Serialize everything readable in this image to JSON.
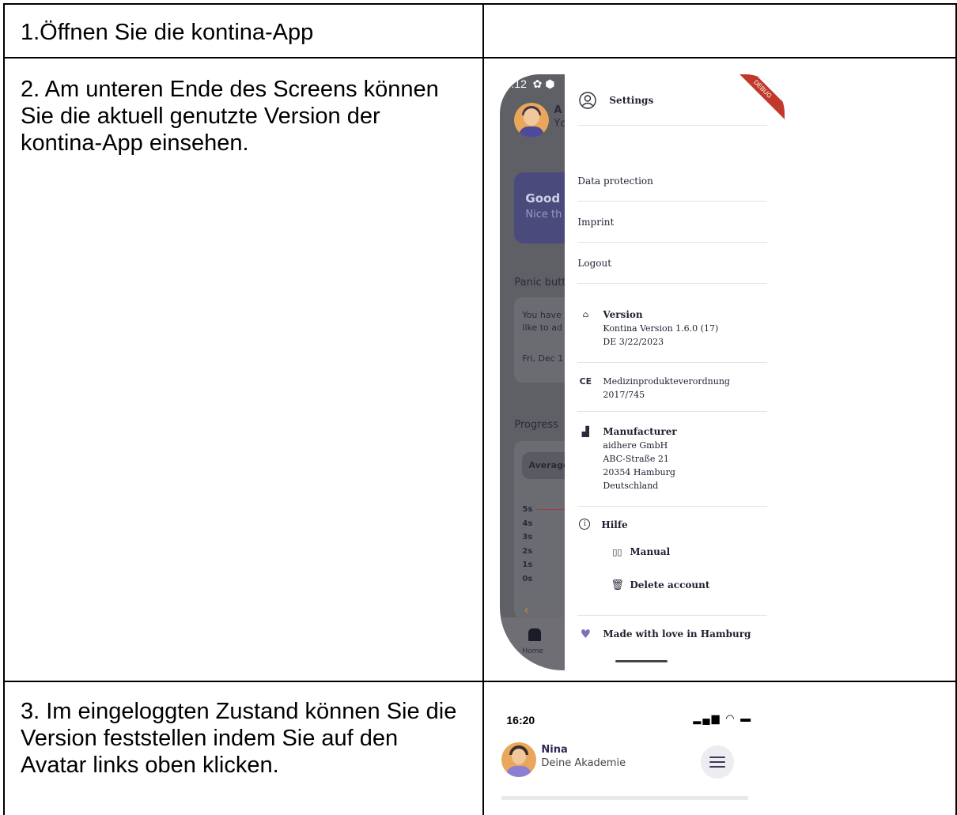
{
  "rows": [
    {
      "text": "1.Öffnen Sie die kontina-App"
    },
    {
      "text": "2. Am unteren Ende des Screens können Sie die aktuell genutzte Version der kontina-App einsehen."
    },
    {
      "text": "3. Im eingeloggten Zustand können Sie die Version feststellen indem Sie auf den Avatar links oben klicken."
    }
  ],
  "phone1": {
    "status_time": ":12",
    "ribbon": "DEBUG",
    "background": {
      "user_initial": "A",
      "user_sub": "Yc",
      "card_title": "Good",
      "card_sub": "Nice th",
      "panic_label": "Panic butt",
      "panic_text1": "You have",
      "panic_text2": "like to ad",
      "panic_date": "Fri, Dec 1",
      "progress_label": "Progress",
      "average_label": "Average",
      "y_ticks": [
        "5s",
        "4s",
        "3s",
        "2s",
        "1s",
        "0s"
      ],
      "nav_home": "Home"
    },
    "drawer": {
      "settings": "Settings",
      "data_protection": "Data protection",
      "imprint": "Imprint",
      "logout": "Logout",
      "version_title": "Version",
      "version_line1": "Kontina Version 1.6.0 (17)",
      "version_line2": "DE 3/22/2023",
      "ce_mark": "CE",
      "mdr_line1": "Medizinprodukteverordnung",
      "mdr_line2": "2017/745",
      "manufacturer_title": "Manufacturer",
      "manufacturer_lines": [
        "aidhere GmbH",
        "ABC-Straße 21",
        "20354 Hamburg",
        "Deutschland"
      ],
      "help_title": "Hilfe",
      "manual": "Manual",
      "delete_account": "Delete account",
      "made_with_love": "Made with love in Hamburg"
    }
  },
  "phone2": {
    "time": "16:20",
    "name": "Nina",
    "subtitle": "Deine Akademie"
  }
}
